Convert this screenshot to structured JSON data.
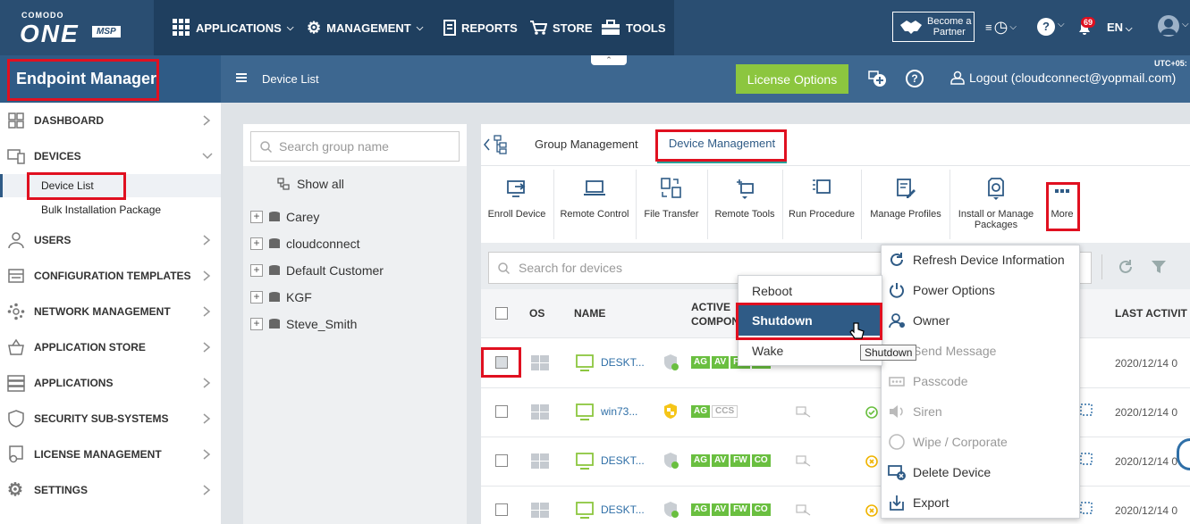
{
  "brand": {
    "small": "COMODO",
    "big": "ONE",
    "tag": "MSP"
  },
  "nav": {
    "applications": "APPLICATIONS",
    "management": "MANAGEMENT",
    "reports": "REPORTS",
    "store": "STORE",
    "tools": "TOOLS"
  },
  "partner": {
    "line1": "Become a",
    "line2": "Partner"
  },
  "notif_count": "69",
  "lang": "EN",
  "utc": "UTC+05:",
  "header": {
    "section_title": "Endpoint Manager",
    "breadcrumb": "Device List",
    "license_button": "License Options",
    "logout": "Logout (cloudconnect@yopmail.com)"
  },
  "sidebar": {
    "items": [
      "DASHBOARD",
      "DEVICES",
      "USERS",
      "CONFIGURATION TEMPLATES",
      "NETWORK MANAGEMENT",
      "APPLICATION STORE",
      "APPLICATIONS",
      "SECURITY SUB-SYSTEMS",
      "LICENSE MANAGEMENT",
      "SETTINGS"
    ],
    "sub_device_list": "Device List",
    "sub_bulk": "Bulk Installation Package"
  },
  "groups": {
    "search_placeholder": "Search group name",
    "show_all": "Show all",
    "list": [
      "Carey",
      "cloudconnect",
      "Default Customer",
      "KGF",
      "Steve_Smith"
    ]
  },
  "tabs": {
    "group": "Group Management",
    "device": "Device Management"
  },
  "toolbar": {
    "enroll": "Enroll Device",
    "remote": "Remote Control",
    "file": "File Transfer",
    "tools": "Remote Tools",
    "procedure": "Run Procedure",
    "profiles": "Manage Profiles",
    "packages1": "Install or Manage",
    "packages2": "Packages",
    "more": "More"
  },
  "device_search_placeholder": "Search for devices",
  "table": {
    "headers": {
      "os": "OS",
      "name": "NAME",
      "active1": "ACTIVE",
      "active2": "COMPON",
      "last": "LAST ACTIVIT"
    },
    "rows": [
      {
        "name": "DESKT...",
        "badges": [
          "AG",
          "AV",
          "FW",
          "CO"
        ],
        "last": "2020/12/14 0"
      },
      {
        "name": "win73...",
        "badges": [
          "AG",
          "CCS"
        ],
        "last": "2020/12/14 0"
      },
      {
        "name": "DESKT...",
        "badges": [
          "AG",
          "AV",
          "FW",
          "CO"
        ],
        "last": "2020/12/14 0"
      },
      {
        "name": "DESKT...",
        "badges": [
          "AG",
          "AV",
          "FW",
          "CO"
        ],
        "last": "2020/12/14 0"
      }
    ]
  },
  "more_menu": [
    "Refresh Device Information",
    "Power Options",
    "Owner",
    "Send Message",
    "Passcode",
    "Siren",
    "Wipe / Corporate",
    "Delete Device",
    "Export"
  ],
  "power_menu": {
    "reboot": "Reboot",
    "shutdown": "Shutdown",
    "wake": "Wake"
  },
  "tooltip": "Shutdown",
  "colors": {
    "topbar": "#2a4e72",
    "accent_green": "#8cc63f",
    "highlight_red": "#e01020",
    "menu_selected": "#2f5b86"
  }
}
